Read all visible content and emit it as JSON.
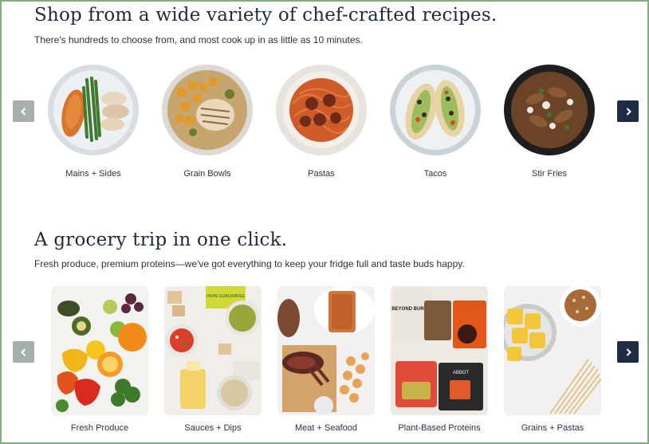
{
  "recipes": {
    "title": "Shop from a wide variety of chef-crafted recipes.",
    "subtitle": "There's hundreds to choose from, and most cook up in as little as 10 minutes.",
    "items": [
      {
        "label": "Mains + Sides"
      },
      {
        "label": "Grain Bowls"
      },
      {
        "label": "Pastas"
      },
      {
        "label": "Tacos"
      },
      {
        "label": "Stir Fries"
      }
    ]
  },
  "grocery": {
    "title": "A grocery trip in one click.",
    "subtitle": "Fresh produce, premium proteins—we've got everything to keep your fridge full and taste buds happy.",
    "items": [
      {
        "label": "Fresh Produce"
      },
      {
        "label": "Sauces + Dips"
      },
      {
        "label": "Meat + Seafood"
      },
      {
        "label": "Plant-Based Proteins"
      },
      {
        "label": "Grains + Pastas"
      }
    ],
    "package_text": {
      "guacamole": "HOPE GUACAMOLE",
      "beyond": "BEYOND BURGER",
      "abbot": "ABBOT"
    }
  },
  "icons": {
    "prev": "chevron-left-icon",
    "next": "chevron-right-icon"
  },
  "colors": {
    "next_button": "#1f2b46",
    "prev_button": "#a7afaa",
    "border": "#7fae7f",
    "text": "#1f2a3a"
  }
}
